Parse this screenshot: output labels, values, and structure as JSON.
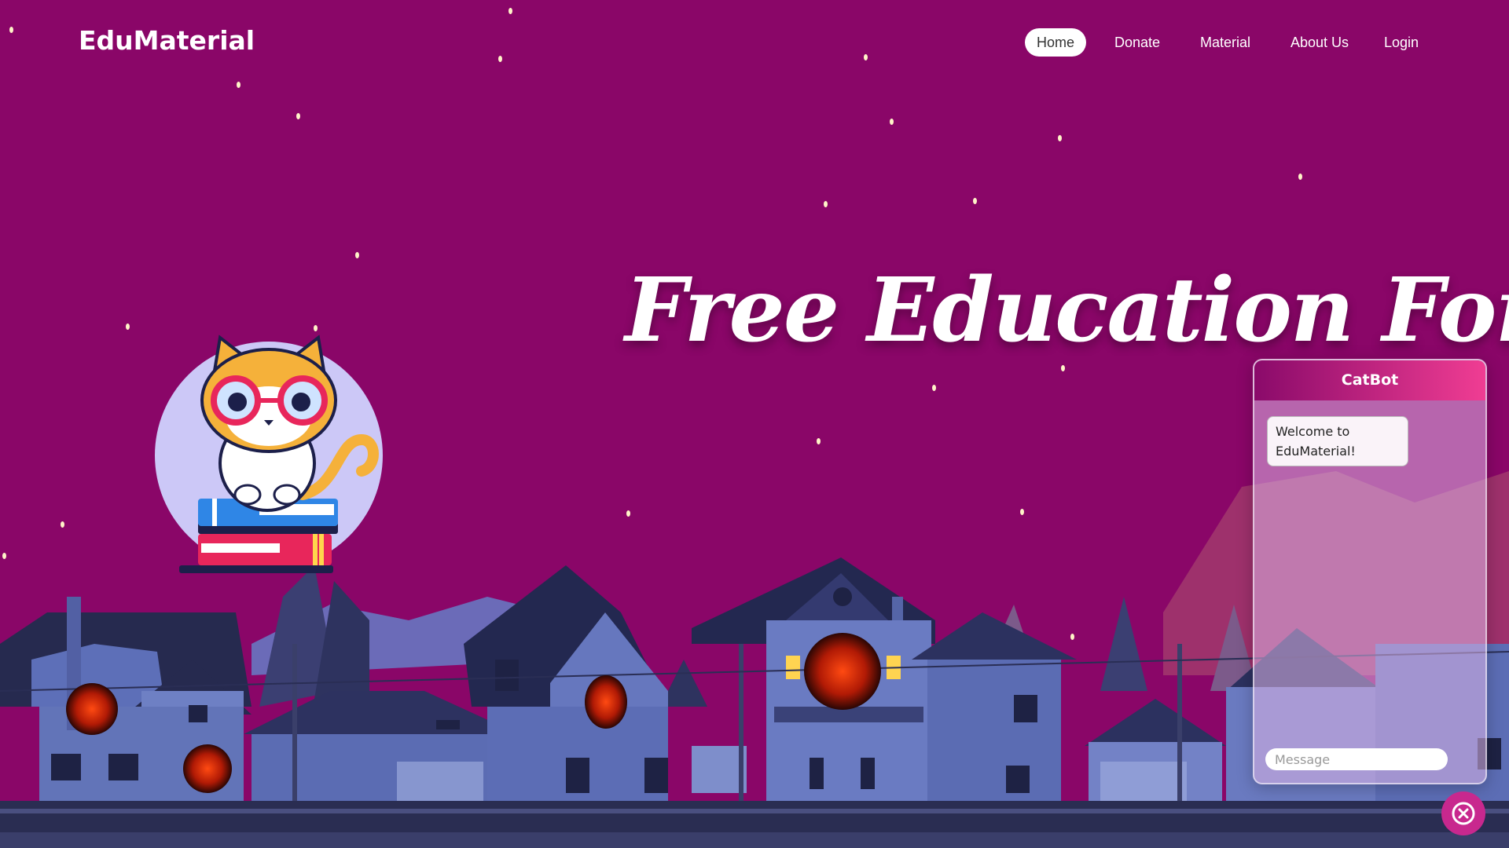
{
  "brand": {
    "name": "EduMaterial"
  },
  "nav": {
    "items": [
      {
        "label": "Home",
        "active": true
      },
      {
        "label": "Donate",
        "active": false
      },
      {
        "label": "Material",
        "active": false
      },
      {
        "label": "About Us",
        "active": false
      },
      {
        "label": "Login",
        "active": false
      }
    ]
  },
  "hero": {
    "title": "Free Education For All"
  },
  "chatbot": {
    "title": "CatBot",
    "welcome_message": "Welcome to EduMaterial!",
    "input_placeholder": "Message",
    "toggle_icon": "close-circle-icon"
  },
  "colors": {
    "sky": "#8a0668",
    "chat_header_start": "#8a0a6a",
    "chat_header_end": "#f03d93",
    "accent": "#c8288e"
  }
}
